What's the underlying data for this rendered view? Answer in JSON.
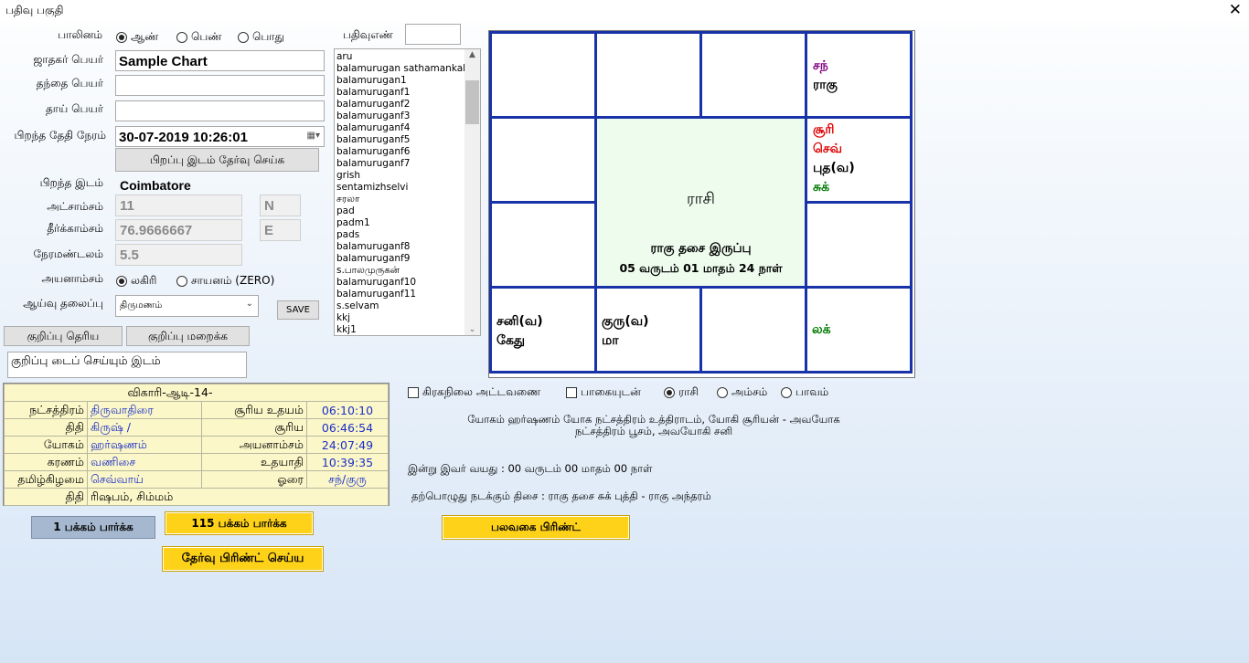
{
  "window": {
    "title": "பதிவு பகுதி",
    "close": "✕"
  },
  "form": {
    "gender_label": "பாலினம்",
    "gender_options": [
      "ஆண்",
      "பெண்",
      "பொது"
    ],
    "name_label": "ஜாதகர் பெயர்",
    "name_value": "Sample Chart",
    "father_label": "தந்தை பெயர்",
    "mother_label": "தாய் பெயர்",
    "dob_label": "பிறந்த தேதி நேரம்",
    "dob_value": "30-07-2019 10:26:01",
    "place_button": "பிறப்பு இடம் தேர்வு செய்க",
    "place_label": "பிறந்த இடம்",
    "place_value": "Coimbatore",
    "lat_label": "அட்சாம்சம்",
    "lat_value": "11",
    "lat_dir": "N",
    "lon_label": "தீர்க்காம்சம்",
    "lon_value": "76.9666667",
    "lon_dir": "E",
    "tz_label": "நேரமண்டலம்",
    "tz_value": "5.5",
    "ayanamsa_label": "அயனாம்சம்",
    "ayanamsa_options": [
      "லகிரி",
      "சாயனம் (ZERO)"
    ],
    "topic_label": "ஆய்வு தலைப்பு",
    "topic_value": "திருமணம்",
    "save": "SAVE",
    "note_show": "குறிப்பு தெரிய",
    "note_hide": "குறிப்பு மறைக்க",
    "note_text": "குறிப்பு டைப் செய்யும் இடம்",
    "reg_label": "பதிவுஎண்"
  },
  "records": [
    "aru",
    "balamurugan sathamankalam",
    "balamurugan1",
    "balamuruganf1",
    "balamuruganf2",
    "balamuruganf3",
    "balamuruganf4",
    "balamuruganf5",
    "balamuruganf6",
    "balamuruganf7",
    "grish",
    "sentamizhselvi",
    "சரலா",
    "pad",
    "padm1",
    "pads",
    "balamuruganf8",
    "balamuruganf9",
    "s.பாலமுருகன்",
    "balamuruganf10",
    "balamuruganf11",
    "s.selvam",
    "kkj",
    "kkj1"
  ],
  "chart": {
    "center_title": "ராசி",
    "center_line1": "ராகு தசை இருப்பு",
    "center_line2": "05 வருடம் 01 மாதம் 24 நாள்",
    "houses": {
      "top3": [
        "சந்",
        "ராகு"
      ],
      "right2": [
        "சூரி",
        "செவ்",
        "புத(வ)",
        "சுக்"
      ],
      "bottom0": [
        "சனி(வ)",
        "கேது"
      ],
      "bottom1": [
        "குரு(வ)",
        "மா"
      ],
      "bottom3": [
        "லக்"
      ]
    },
    "colors": {
      "சந்": "#800080",
      "சூரி": "#e00000",
      "செவ்": "#e00000",
      "சுக்": "#007a00",
      "லக்": "#007a00",
      "default": "#000000",
      "grid": "#1832a8",
      "center": "#eefcee"
    }
  },
  "options": {
    "graha_table": "கிரகநிலை அட்டவணை",
    "with_parts": "பாகையுடன்",
    "views": [
      "ராசி",
      "அம்சம்",
      "பாவம்"
    ]
  },
  "yoga_text": "யோகம் ஹர்ஷணம் யோக நட்சத்திரம் உத்திராடம், யோகி சூரியன் - அவயோக\nநட்சத்திரம் பூசம், அவயோகி சனி",
  "age_text": "இன்று இவர் வயது :  00 வருடம் 00 மாதம் 00 நாள்",
  "dasa_text": "தற்பொழுது நடக்கும் திசை :  ராகு தசை சுக் புத்தி - ராகு அந்தரம்",
  "panchang": {
    "header": "விகாரி-ஆடி-14-",
    "rows": [
      {
        "k1": "நட்சத்திரம்",
        "v1": "திருவாதிரை",
        "k2": "சூரிய உதயம்",
        "v2": "06:10:10"
      },
      {
        "k1": "திதி",
        "v1": "கிருஷ் /",
        "k2": "சூரிய",
        "v2": "06:46:54"
      },
      {
        "k1": "யோகம்",
        "v1": "ஹர்ஷணம்",
        "k2": "அயனாம்சம்",
        "v2": "24:07:49"
      },
      {
        "k1": "கரணம்",
        "v1": "வணிசை",
        "k2": "உதயாதி",
        "v2": "10:39:35"
      },
      {
        "k1": "தமிழ்கிழமை",
        "v1": "செவ்வாய்",
        "k2": "ஓரை",
        "v2": "சந்/குரு"
      }
    ],
    "last_k": "திதி",
    "last_v": "ரிஷபம், சிம்மம்"
  },
  "buttons": {
    "page1": "1 பக்கம் பார்க்க",
    "page115": "115 பக்கம் பார்க்க",
    "select_print": "தேர்வு பிரிண்ட் செய்ய",
    "multi_print": "பலவகை பிரிண்ட்"
  }
}
